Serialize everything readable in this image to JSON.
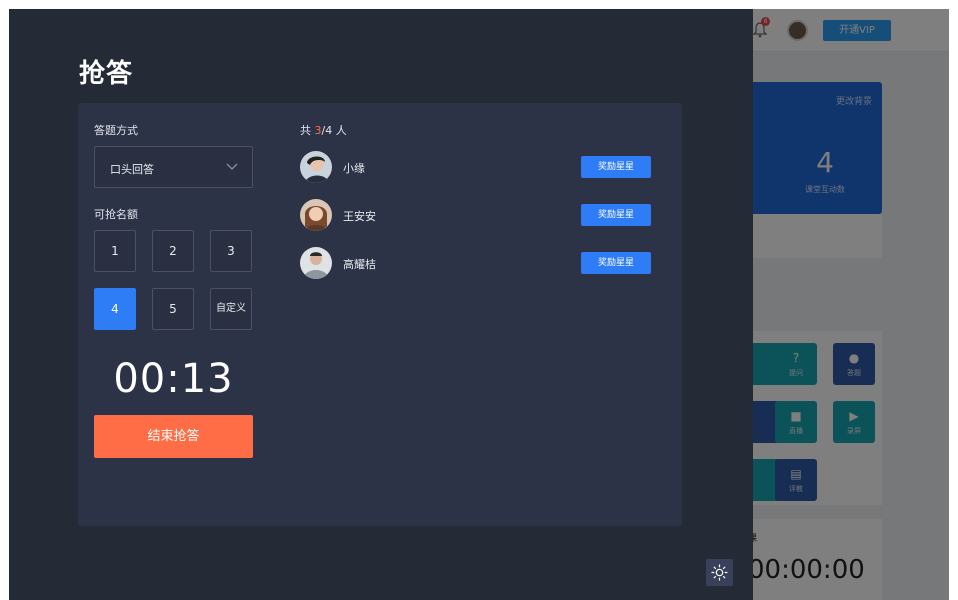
{
  "background_app": {
    "vip_label": "开通VIP",
    "notification_count": "8",
    "card_corner": "更改背景",
    "card_number": "4",
    "card_label": "课堂互动数",
    "tools": [
      {
        "label": "提问",
        "icon": "question-icon"
      },
      {
        "label": "答题",
        "icon": "medal-icon"
      },
      {
        "label": "直播",
        "icon": "camera-icon"
      },
      {
        "label": "录屏",
        "icon": "video-icon"
      },
      {
        "label": "评教",
        "icon": "document-icon"
      }
    ],
    "timer_label": "课",
    "timer_value": "00:00:00"
  },
  "modal": {
    "title": "抢答",
    "mode_label": "答题方式",
    "mode_value": "口头回答",
    "quota_label": "可抢名额",
    "quota_options": [
      "1",
      "2",
      "3",
      "4",
      "5",
      "自定义"
    ],
    "quota_selected": "4",
    "countdown": "00:13",
    "end_button": "结束抢答",
    "count_prefix": "共 ",
    "count_current": "3",
    "count_suffix": "/4 人",
    "participants": [
      {
        "name": "小缘",
        "action": "奖励星星"
      },
      {
        "name": "王安安",
        "action": "奖励星星"
      },
      {
        "name": "高耀桔",
        "action": "奖励星星"
      }
    ]
  },
  "colors": {
    "modal_bg": "#252a37",
    "panel_bg": "#2d3346",
    "accent_blue": "#2e7cf6",
    "accent_orange": "#ff6d46"
  }
}
